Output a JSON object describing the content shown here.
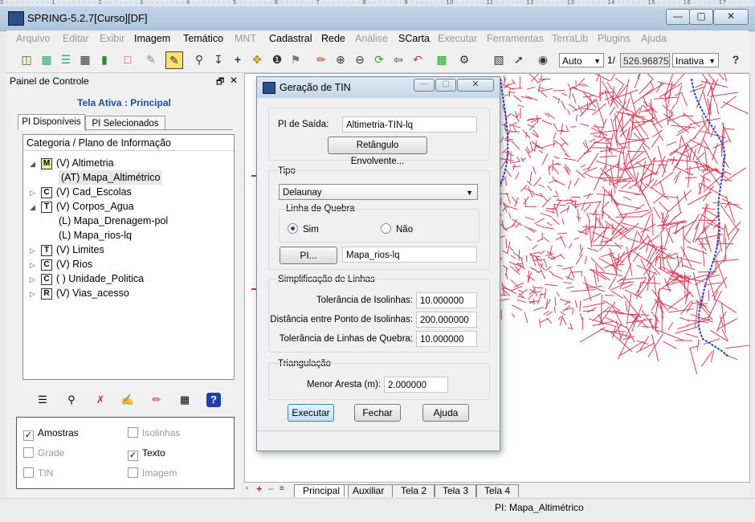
{
  "window": {
    "title": "SPRING-5.2.7[Curso][DF]",
    "ruler_text": "3 · · · · · · · · · 1 · · · · · · · · 2 · · · · · · · 3 · · · · · · · · 4 · · · · · · · · 5 · · · · · · · 6 · · · · · · · 7 · · · · · · · · 8 · · · · · · · 9 · · · · · · · 10 · · · · · · 11 · · · · · · 12 · · · · · · 13 · · · · · · 14 · · · · · · 15 · · · · · 16 · · · · · 17 · · · ·",
    "minimize": "—",
    "maximize": "▢",
    "close": "✕"
  },
  "menu": [
    {
      "label": "Arquivo",
      "enabled": false
    },
    {
      "label": "Editar",
      "enabled": false
    },
    {
      "label": "Exibir",
      "enabled": false
    },
    {
      "label": "Imagem",
      "enabled": true
    },
    {
      "label": "Temático",
      "enabled": true
    },
    {
      "label": "MNT",
      "enabled": false
    },
    {
      "label": "Cadastral",
      "enabled": true
    },
    {
      "label": "Rede",
      "enabled": true
    },
    {
      "label": "Análise",
      "enabled": false
    },
    {
      "label": "SCarta",
      "enabled": true
    },
    {
      "label": "Executar",
      "enabled": false
    },
    {
      "label": "Ferramentas",
      "enabled": false
    },
    {
      "label": "TerraLib",
      "enabled": false
    },
    {
      "label": "Plugins",
      "enabled": false
    },
    {
      "label": "Ajuda",
      "enabled": false
    }
  ],
  "toolbar": {
    "scale_mode": "Auto",
    "scale_prefix": "1/",
    "scale_value": "526.968750",
    "state": "Inativa",
    "help": "?"
  },
  "panel": {
    "title": "Painel de Controle",
    "float_icon": "🗗",
    "close_icon": "✕",
    "tela_ativa": "Tela Ativa : Principal",
    "tabs": [
      "PI Disponíveis",
      "PI Selecionados"
    ],
    "tree_header": "Categoria / Plano de Informação",
    "tree": [
      {
        "expander": "◢",
        "letter": "M",
        "label": "(V) Altimetria",
        "indent": 0,
        "selected": false
      },
      {
        "expander": "",
        "letter": "",
        "label": "(AT) Mapa_Altimétrico",
        "indent": 1,
        "selected": true
      },
      {
        "expander": "▷",
        "letter": "C",
        "label": "(V) Cad_Escolas",
        "indent": 0,
        "selected": false
      },
      {
        "expander": "◢",
        "letter": "T",
        "label": "(V) Corpos_Agua",
        "indent": 0,
        "selected": false
      },
      {
        "expander": "",
        "letter": "",
        "label": "(L) Mapa_Drenagem-pol",
        "indent": 1,
        "selected": false
      },
      {
        "expander": "",
        "letter": "",
        "label": "(L) Mapa_rios-lq",
        "indent": 1,
        "selected": false
      },
      {
        "expander": "▷",
        "letter": "T",
        "label": "(V) Limites",
        "indent": 0,
        "selected": false
      },
      {
        "expander": "▷",
        "letter": "C",
        "label": "(V) Rios",
        "indent": 0,
        "selected": false
      },
      {
        "expander": "▷",
        "letter": "C",
        "label": "( ) Unidade_Politica",
        "indent": 0,
        "selected": false
      },
      {
        "expander": "▷",
        "letter": "R",
        "label": "(V) Vias_acesso",
        "indent": 0,
        "selected": false
      }
    ],
    "checks": [
      {
        "label": "Amostras",
        "checked": true,
        "enabled": true
      },
      {
        "label": "Isolinhas",
        "checked": false,
        "enabled": false
      },
      {
        "label": "Grade",
        "checked": false,
        "enabled": false
      },
      {
        "label": "Texto",
        "checked": true,
        "enabled": true
      },
      {
        "label": "TIN",
        "checked": false,
        "enabled": false
      },
      {
        "label": "Imagem",
        "checked": false,
        "enabled": false
      }
    ]
  },
  "dialog": {
    "title": "Geração de TIN",
    "pi_saida_label": "PI de Saída:",
    "pi_saida_value": "Altimetria-TIN-lq",
    "retangulo_button": "Retângulo Envolvente...",
    "tipo_label": "Tipo",
    "tipo_value": "Delaunay",
    "linha_quebra_label": "Linha de Quebra",
    "sim_label": "Sim",
    "nao_label": "Não",
    "pi_button": "PI...",
    "pi_value": "Mapa_rios-lq",
    "simplificacao_label": "Simplificação de Linhas",
    "tol_isolinhas_label": "Tolerância de Isolinhas:",
    "tol_isolinhas_value": "10.000000",
    "dist_pontos_label": "Distância entre Ponto de Isolinhas:",
    "dist_pontos_value": "200.000000",
    "tol_quebra_label": "Tolerância de Linhas de Quebra:",
    "tol_quebra_value": "10.000000",
    "triangulacao_label": "Triangulação",
    "menor_aresta_label": "Menor Aresta (m):",
    "menor_aresta_value": "2.000000",
    "executar": "Executar",
    "fechar": "Fechar",
    "ajuda": "Ajuda"
  },
  "bottom_tabs": [
    "Principal",
    "Auxiliar",
    "Tela 2",
    "Tela 3",
    "Tela 4"
  ],
  "status": "PI: Mapa_Altimétrico",
  "colors": {
    "map_lines": "#d0405a",
    "river": "#2a3fd0",
    "accent_blue": "#1a4fa0"
  }
}
